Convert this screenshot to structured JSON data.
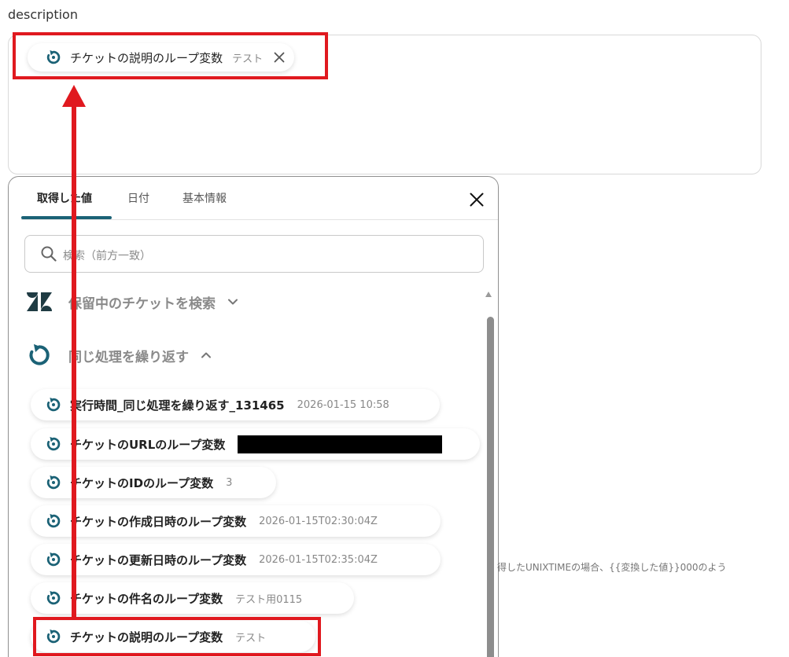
{
  "field": {
    "label": "description"
  },
  "chip": {
    "name": "チケットの説明のループ変数",
    "value": "テスト",
    "remove_icon": "close-icon"
  },
  "panel": {
    "tabs": [
      {
        "label": "取得した値",
        "active": true
      },
      {
        "label": "日付",
        "active": false
      },
      {
        "label": "基本情報",
        "active": false
      }
    ],
    "close_icon": "close-icon",
    "search": {
      "placeholder": "検索（前方一致）",
      "icon": "search-icon"
    },
    "sections": [
      {
        "label": "保留中のチケットを検索",
        "icon": "zendesk-icon",
        "expanded": false
      },
      {
        "label": "同じ処理を繰り返す",
        "icon": "loop-icon",
        "expanded": true
      }
    ],
    "items": [
      {
        "name": "実行時間_同じ処理を繰り返す_131465",
        "value": "2026-01-15 10:58"
      },
      {
        "name": "チケットのURLのループ変数",
        "value": "",
        "redacted": true
      },
      {
        "name": "チケットのIDのループ変数",
        "value": "3"
      },
      {
        "name": "チケットの作成日時のループ変数",
        "value": "2026-01-15T02:30:04Z"
      },
      {
        "name": "チケットの更新日時のループ変数",
        "value": "2026-01-15T02:35:04Z"
      },
      {
        "name": "チケットの件名のループ変数",
        "value": "テスト用0115"
      },
      {
        "name": "チケットの説明のループ変数",
        "value": "テスト"
      }
    ]
  },
  "background_hint": "得したUNIXTIMEの場合、{{変換した値}}000のよう",
  "colors": {
    "accent": "#1b6276",
    "highlight": "#e0191f"
  }
}
